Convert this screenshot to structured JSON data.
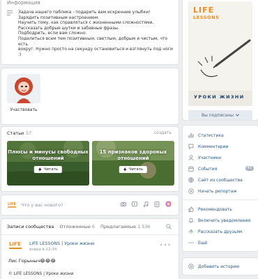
{
  "info": {
    "title": "Информация",
    "text": "Задача нашего паблика - подарить вам искренние улыбки!\nЗарядить позитивным настроением.\nНаучить тому, как справляться с жизненными сложностями.\nРассказать добрые шутки и забавные фразы.\nПодбодрить, если вам сложно.\nПоделиться всем тем позитивным, светлым, добрым и чистым, что есть\nвокруг. Нужно просто на секунду остановиться и взглянуть под ноги :)"
  },
  "participate": {
    "label": "Участвовать"
  },
  "articles": {
    "title": "Статьи",
    "count": "57",
    "create": "создать",
    "items": [
      {
        "title": "Плюсы и минусы свободных отношений",
        "button": "Читать"
      },
      {
        "title": "15 признаков здоровых отношений",
        "button": "Читать"
      }
    ]
  },
  "composer": {
    "placeholder": "Что у вас нового?"
  },
  "wall": {
    "tab_active": "Записи сообщества",
    "tab_deferred": "Отложенные",
    "deferred_count": "6",
    "tab_suggested": "Предлагаемые",
    "suggested_count": "1 536",
    "post": {
      "author": "LIFE LESSONS | Уроки жизни",
      "date": "вчера в 22:34",
      "text": "Лис Горыныч😂😂😂",
      "source": "© LIFE LESSONS | Уроки жизни"
    }
  },
  "cover": {
    "brand": "LIFE",
    "brand_sub": "LESSONS",
    "ru_title": "УРОКИ ЖИЗНИ",
    "subscribed": "Вы подписаны"
  },
  "menu": {
    "statistics": "Статистика",
    "comments": "Комментарии",
    "members": "Участники",
    "events": "События",
    "events_badge": "45",
    "site": "Сайт из сообщества",
    "live": "Начать репортаж",
    "recommend": "Рекомендовать",
    "notifications": "Включить уведомления",
    "tell": "Рассказать друзьям",
    "more": "Ещё"
  },
  "history": {
    "add": "Добавить историю"
  },
  "colors": {
    "accent": "#2a5885",
    "brand": "#f28a1c",
    "background": "#edeef0"
  }
}
